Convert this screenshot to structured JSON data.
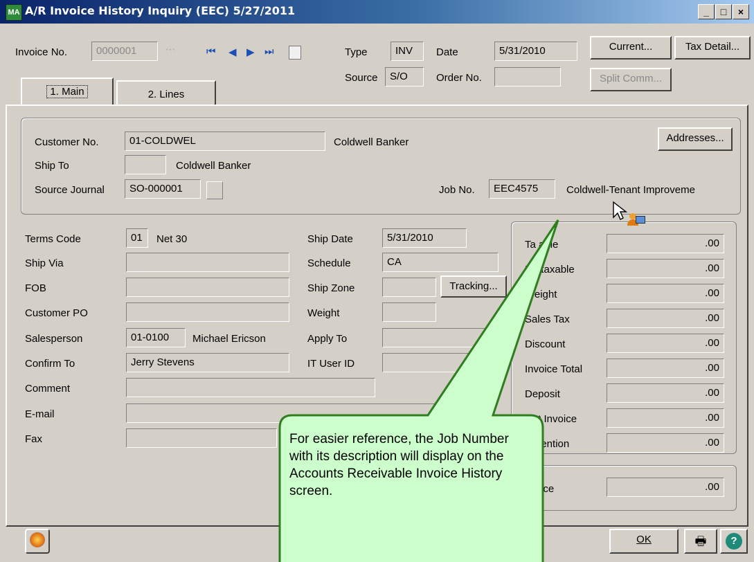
{
  "window": {
    "title": "A/R Invoice History Inquiry (EEC) 5/27/2011",
    "app_icon": "MA",
    "minimize": "_",
    "maximize": "□",
    "close": "×"
  },
  "header": {
    "invoice_no_label": "Invoice No.",
    "invoice_no": "0000001",
    "type_label": "Type",
    "type": "INV",
    "date_label": "Date",
    "date": "5/31/2010",
    "source_label": "Source",
    "source": "S/O",
    "order_no_label": "Order No.",
    "order_no": "",
    "current_btn": "Current...",
    "tax_detail_btn": "Tax Detail...",
    "split_comm_btn": "Split Comm..."
  },
  "tabs": [
    {
      "label": "1. Main"
    },
    {
      "label": "2. Lines"
    }
  ],
  "customer": {
    "customer_no_label": "Customer No.",
    "customer_no": "01-COLDWEL",
    "customer_name": "Coldwell Banker",
    "ship_to_label": "Ship To",
    "ship_to": "",
    "ship_to_name": "Coldwell Banker",
    "source_journal_label": "Source Journal",
    "source_journal": "SO-000001",
    "job_no_label": "Job No.",
    "job_no": "EEC4575",
    "job_desc": "Coldwell-Tenant Improveme",
    "addresses_btn": "Addresses..."
  },
  "left": {
    "terms_code_label": "Terms Code",
    "terms_code": "01",
    "terms_desc": "Net 30",
    "ship_via_label": "Ship Via",
    "fob_label": "FOB",
    "customer_po_label": "Customer PO",
    "salesperson_label": "Salesperson",
    "salesperson": "01-0100",
    "salesperson_name": "Michael Ericson",
    "confirm_to_label": "Confirm To",
    "confirm_to": "Jerry Stevens",
    "comment_label": "Comment",
    "email_label": "E-mail",
    "fax_label": "Fax"
  },
  "middle": {
    "ship_date_label": "Ship Date",
    "ship_date": "5/31/2010",
    "schedule_label": "Schedule",
    "schedule": "CA",
    "ship_zone_label": "Ship Zone",
    "tracking_btn": "Tracking...",
    "weight_label": "Weight",
    "apply_to_label": "Apply To",
    "it_user_label": "IT User ID"
  },
  "totals": {
    "rows": [
      {
        "label": "Ta  able",
        "value": ".00"
      },
      {
        "label": "N  ntaxable",
        "value": ".00"
      },
      {
        "label": "Weight",
        "value": ".00"
      },
      {
        "label": "Sales Tax",
        "value": ".00"
      },
      {
        "label": "Discount",
        "value": ".00"
      },
      {
        "label": "Invoice Total",
        "value": ".00"
      },
      {
        "label": "Deposit",
        "value": ".00"
      },
      {
        "label": "Net Invoice",
        "value": ".00"
      },
      {
        "label": "Retention",
        "value": ".00"
      }
    ],
    "balance_label": "alance",
    "balance": ".00"
  },
  "footer": {
    "ok_btn": "OK"
  },
  "callout": {
    "text": "For easier reference, the Job Number with its description will display on the Accounts Receivable Invoice History screen.",
    "fill": "#ccffcc",
    "stroke": "#2e7d1e"
  },
  "icons": [
    "first-record-icon",
    "prev-record-icon",
    "next-record-icon",
    "last-record-icon",
    "calendar-icon",
    "print-icon",
    "help-icon",
    "mouse-cursor-icon",
    "user-icon",
    "lookup-icon"
  ]
}
